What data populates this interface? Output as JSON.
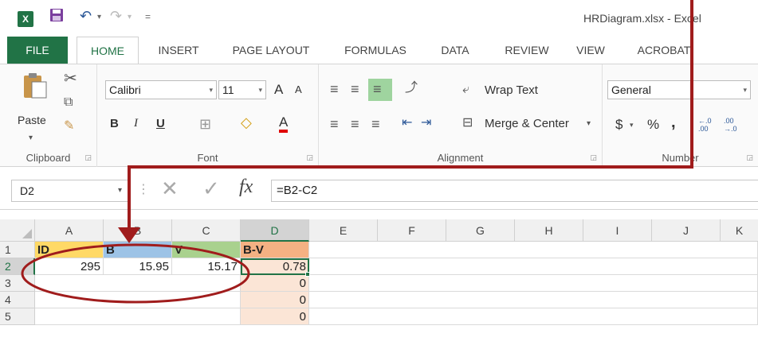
{
  "titlebar": {
    "app_icon": "excel-logo-icon",
    "app_icon_text": "X",
    "title": "HRDiagram.xlsx - Excel"
  },
  "tabs": [
    {
      "label": "FILE"
    },
    {
      "label": "HOME"
    },
    {
      "label": "INSERT"
    },
    {
      "label": "PAGE LAYOUT"
    },
    {
      "label": "FORMULAS"
    },
    {
      "label": "DATA"
    },
    {
      "label": "REVIEW"
    },
    {
      "label": "VIEW"
    },
    {
      "label": "ACROBAT"
    }
  ],
  "ribbon": {
    "clipboard": {
      "label": "Clipboard",
      "paste": "Paste"
    },
    "font": {
      "label": "Font",
      "name": "Calibri",
      "size": "11",
      "grow": "A",
      "shrink": "A",
      "bold": "B",
      "italic": "I",
      "underline": "U",
      "font_color": "A"
    },
    "alignment": {
      "label": "Alignment",
      "wrap_text": "Wrap Text",
      "merge_center": "Merge & Center"
    },
    "number": {
      "label": "Number",
      "format": "General",
      "currency": "$",
      "percent": "%",
      "comma": ",",
      "inc_decimal": "←.0 .00",
      "dec_decimal": ".00 →.0"
    }
  },
  "formula_bar": {
    "name_box": "D2",
    "fx": "fx",
    "formula": "=B2-C2"
  },
  "grid": {
    "columns": [
      "A",
      "B",
      "C",
      "D",
      "E",
      "F",
      "G",
      "H",
      "I",
      "J",
      "K"
    ],
    "rows": [
      "1",
      "2",
      "3",
      "4",
      "5"
    ],
    "row1": [
      "ID",
      "B",
      "V",
      "B-V"
    ],
    "row2": [
      "295",
      "15.95",
      "15.17",
      "0.78"
    ],
    "row3_d": "0",
    "row4_d": "0",
    "row5_d": "0"
  },
  "colors": {
    "excel_green": "#217346",
    "header_id_fill": "#ffd966",
    "header_b_fill": "#9dc3e6",
    "header_v_fill": "#a9d18e",
    "header_bv_fill": "#f4b183",
    "column_d_fill": "#fbe5d6",
    "annotation_red": "#a01c1c"
  }
}
